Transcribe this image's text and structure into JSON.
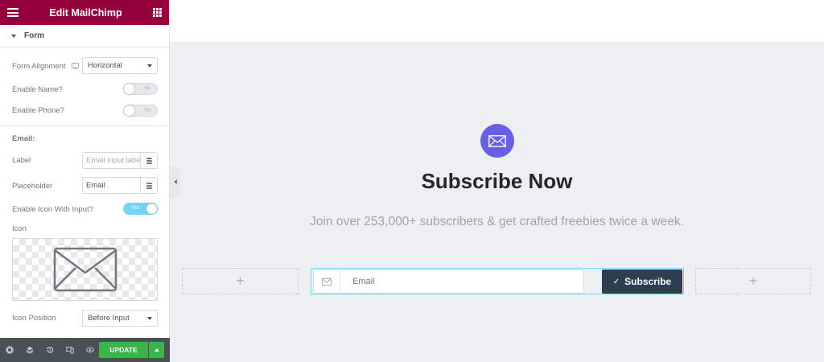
{
  "app": {
    "title": "Edit MailChimp"
  },
  "panel": {
    "section_title": "Form",
    "form_alignment": {
      "label": "Form Alignment",
      "value": "Horizontal"
    },
    "enable_name": {
      "label": "Enable Name?",
      "toggle": "NO"
    },
    "enable_phone": {
      "label": "Enable Phone?",
      "toggle": "NO"
    },
    "email_heading": "Email:",
    "label_field": {
      "label": "Label",
      "placeholder": "Email input label"
    },
    "placeholder_field": {
      "label": "Placeholder",
      "value": "Email"
    },
    "enable_icon": {
      "label": "Enable Icon With Input?",
      "toggle": "YES"
    },
    "icon_label": "Icon",
    "icon_position": {
      "label": "Icon Position",
      "value": "Before Input"
    },
    "update_label": "UPDATE"
  },
  "preview": {
    "title": "Subscribe Now",
    "subtitle": "Join over 253,000+ subscribers & get crafted freebies twice a week.",
    "email_placeholder": "Email",
    "button_label": "Subscribe",
    "add_icon": "+"
  },
  "colors": {
    "topbar": "#93003c",
    "accent_icon": "#6760e5",
    "button": "#2c3e50",
    "update": "#39b54a",
    "toggle_on": "#71d7f7"
  }
}
